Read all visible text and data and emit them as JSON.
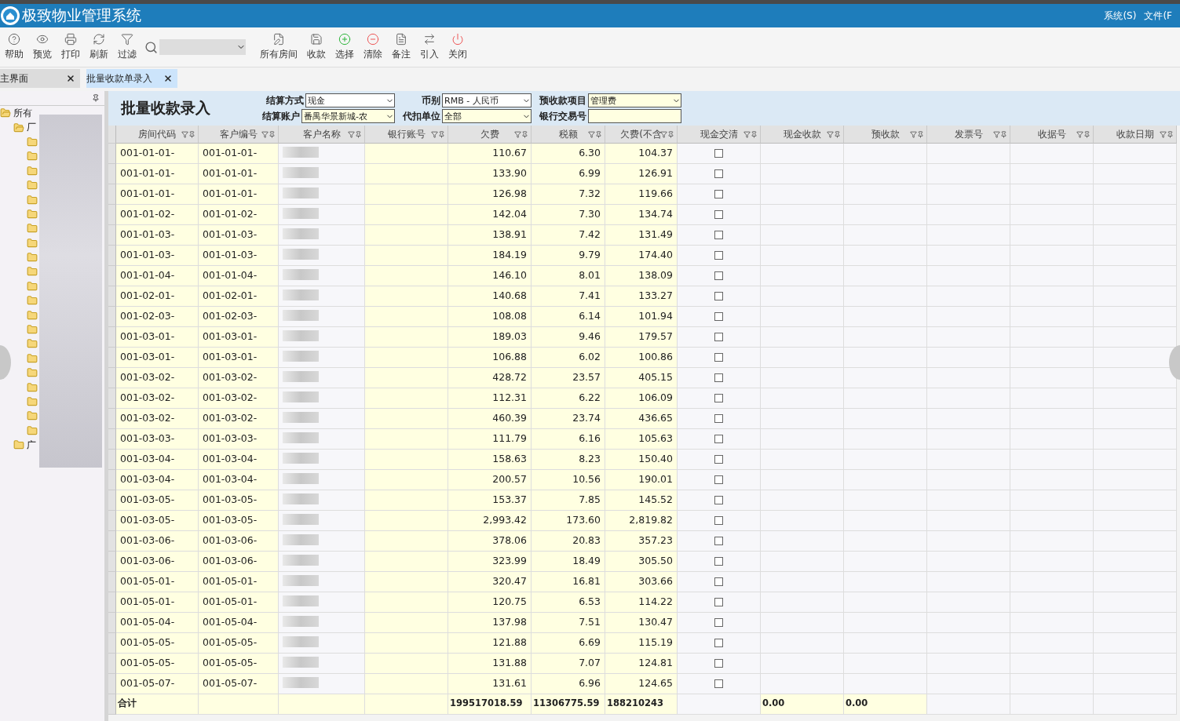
{
  "window": {
    "title": "极致物业管理系统",
    "menus": [
      "系统(S)",
      "文件(F"
    ]
  },
  "toolbar": [
    {
      "label": "帮助",
      "kind": "help"
    },
    {
      "label": "预览",
      "kind": "eye"
    },
    {
      "label": "打印",
      "kind": "print"
    },
    {
      "label": "刷新",
      "kind": "refresh"
    },
    {
      "label": "过滤",
      "kind": "filter"
    },
    {
      "kind": "search"
    },
    {
      "label": "所有房间",
      "kind": "edit"
    },
    {
      "label": "收款",
      "kind": "save"
    },
    {
      "label": "选择",
      "kind": "add"
    },
    {
      "label": "清除",
      "kind": "remove"
    },
    {
      "label": "备注",
      "kind": "note"
    },
    {
      "label": "引入",
      "kind": "swap"
    },
    {
      "label": "关闭",
      "kind": "power"
    }
  ],
  "tabs": [
    {
      "label": "主界面",
      "selected": false
    },
    {
      "label": "批量收款单录入",
      "selected": true
    }
  ],
  "tree": [
    {
      "label": "所有",
      "expanded": true,
      "children": [
        {
          "label": "厂",
          "expanded": true,
          "children": [
            {
              "expanded": false
            },
            {
              "expanded": false
            },
            {
              "expanded": false
            },
            {
              "expanded": false
            },
            {
              "expanded": false
            },
            {
              "expanded": false
            },
            {
              "expanded": false
            },
            {
              "expanded": false
            },
            {
              "expanded": false
            },
            {
              "expanded": false
            },
            {
              "expanded": false
            },
            {
              "expanded": false
            },
            {
              "expanded": false
            },
            {
              "expanded": false
            },
            {
              "expanded": false
            },
            {
              "expanded": false
            },
            {
              "expanded": false
            },
            {
              "expanded": false
            },
            {
              "expanded": false
            },
            {
              "expanded": false
            },
            {
              "expanded": false
            }
          ]
        },
        {
          "label": "广",
          "expanded": false
        }
      ]
    }
  ],
  "form": {
    "title": "批量收款录入",
    "fields": [
      {
        "label": "结算方式",
        "value": "现金",
        "highlight": false
      },
      {
        "label": "币别",
        "value": "RMB - 人民币",
        "highlight": false
      },
      {
        "label": "预收款项目",
        "value": "管理费",
        "highlight": true
      },
      {
        "label": "结算账户",
        "value": "番禺华景新城-农",
        "highlight": true
      },
      {
        "label": "代扣单位",
        "value": "全部",
        "highlight": true
      },
      {
        "label": "银行交易号",
        "kind": "text",
        "highlight": true
      }
    ]
  },
  "table": {
    "columns": [
      "房间代码",
      "客户编号",
      "客户名称",
      "银行账号",
      "欠费",
      "税额",
      "欠费(不含",
      "现金交清",
      "现金收款",
      "预收款",
      "发票号",
      "收据号",
      "收款日期"
    ],
    "rows": [
      {
        "room": "001-01-01-",
        "customer": "001-01-01-",
        "owed": "110.67",
        "tax": "6.30",
        "net": "104.37",
        "settled": false
      },
      {
        "room": "001-01-01-",
        "customer": "001-01-01-",
        "owed": "133.90",
        "tax": "6.99",
        "net": "126.91",
        "settled": false
      },
      {
        "room": "001-01-01-",
        "customer": "001-01-01-",
        "owed": "126.98",
        "tax": "7.32",
        "net": "119.66",
        "settled": false
      },
      {
        "room": "001-01-02-",
        "customer": "001-01-02-",
        "owed": "142.04",
        "tax": "7.30",
        "net": "134.74",
        "settled": false
      },
      {
        "room": "001-01-03-",
        "customer": "001-01-03-",
        "owed": "138.91",
        "tax": "7.42",
        "net": "131.49",
        "settled": false
      },
      {
        "room": "001-01-03-",
        "customer": "001-01-03-",
        "owed": "184.19",
        "tax": "9.79",
        "net": "174.40",
        "settled": false
      },
      {
        "room": "001-01-04-",
        "customer": "001-01-04-",
        "owed": "146.10",
        "tax": "8.01",
        "net": "138.09",
        "settled": false
      },
      {
        "room": "001-02-01-",
        "customer": "001-02-01-",
        "owed": "140.68",
        "tax": "7.41",
        "net": "133.27",
        "settled": false
      },
      {
        "room": "001-02-03-",
        "customer": "001-02-03-",
        "owed": "108.08",
        "tax": "6.14",
        "net": "101.94",
        "settled": false
      },
      {
        "room": "001-03-01-",
        "customer": "001-03-01-",
        "owed": "189.03",
        "tax": "9.46",
        "net": "179.57",
        "settled": false
      },
      {
        "room": "001-03-01-",
        "customer": "001-03-01-",
        "owed": "106.88",
        "tax": "6.02",
        "net": "100.86",
        "settled": false
      },
      {
        "room": "001-03-02-",
        "customer": "001-03-02-",
        "owed": "428.72",
        "tax": "23.57",
        "net": "405.15",
        "settled": false
      },
      {
        "room": "001-03-02-",
        "customer": "001-03-02-",
        "owed": "112.31",
        "tax": "6.22",
        "net": "106.09",
        "settled": false
      },
      {
        "room": "001-03-02-",
        "customer": "001-03-02-",
        "owed": "460.39",
        "tax": "23.74",
        "net": "436.65",
        "settled": false
      },
      {
        "room": "001-03-03-",
        "customer": "001-03-03-",
        "owed": "111.79",
        "tax": "6.16",
        "net": "105.63",
        "settled": false
      },
      {
        "room": "001-03-04-",
        "customer": "001-03-04-",
        "owed": "158.63",
        "tax": "8.23",
        "net": "150.40",
        "settled": false
      },
      {
        "room": "001-03-04-",
        "customer": "001-03-04-",
        "owed": "200.57",
        "tax": "10.56",
        "net": "190.01",
        "settled": false
      },
      {
        "room": "001-03-05-",
        "customer": "001-03-05-",
        "owed": "153.37",
        "tax": "7.85",
        "net": "145.52",
        "settled": false
      },
      {
        "room": "001-03-05-",
        "customer": "001-03-05-",
        "owed": "2,993.42",
        "tax": "173.60",
        "net": "2,819.82",
        "settled": false
      },
      {
        "room": "001-03-06-",
        "customer": "001-03-06-",
        "owed": "378.06",
        "tax": "20.83",
        "net": "357.23",
        "settled": false
      },
      {
        "room": "001-03-06-",
        "customer": "001-03-06-",
        "owed": "323.99",
        "tax": "18.49",
        "net": "305.50",
        "settled": false
      },
      {
        "room": "001-05-01-",
        "customer": "001-05-01-",
        "owed": "320.47",
        "tax": "16.81",
        "net": "303.66",
        "settled": false
      },
      {
        "room": "001-05-01-",
        "customer": "001-05-01-",
        "owed": "120.75",
        "tax": "6.53",
        "net": "114.22",
        "settled": false
      },
      {
        "room": "001-05-04-",
        "customer": "001-05-04-",
        "owed": "137.98",
        "tax": "7.51",
        "net": "130.47",
        "settled": false
      },
      {
        "room": "001-05-05-",
        "customer": "001-05-05-",
        "owed": "121.88",
        "tax": "6.69",
        "net": "115.19",
        "settled": false
      },
      {
        "room": "001-05-05-",
        "customer": "001-05-05-",
        "owed": "131.88",
        "tax": "7.07",
        "net": "124.81",
        "settled": false
      },
      {
        "room": "001-05-07-",
        "customer": "001-05-07-",
        "owed": "131.61",
        "tax": "6.96",
        "net": "124.65",
        "settled": false
      }
    ],
    "totals": {
      "label": "合计",
      "owed": "199517018.59",
      "tax": "11306775.59",
      "net": "188210243",
      "cash": "0.00",
      "prepaid": "0.00"
    }
  }
}
